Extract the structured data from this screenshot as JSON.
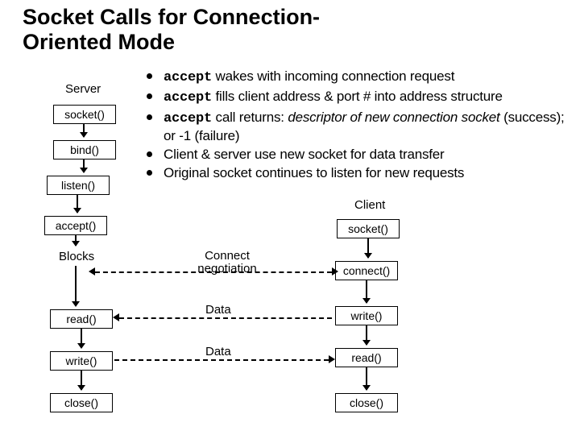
{
  "title": "Socket Calls for Connection-Oriented Mode",
  "title_line1": "Socket Calls for Connection-",
  "title_line2": "Oriented Mode",
  "bullets": {
    "b1_mono": "accept",
    "b1_rest": " wakes with incoming connection request",
    "b2_mono": "accept",
    "b2_rest": " fills client address & port # into address structure",
    "b3_mono": "accept",
    "b3_mid": " call returns: ",
    "b3_em": "descriptor of new connection socket",
    "b3_tail": " (success); or -1 (failure)",
    "b4": "Client & server use new socket for data transfer",
    "b5": "Original socket continues to listen for new requests"
  },
  "labels": {
    "server": "Server",
    "client": "Client",
    "blocks": "Blocks",
    "connect_neg": "Connect negotiation",
    "data": "Data"
  },
  "server_boxes": [
    "socket()",
    "bind()",
    "listen()",
    "accept()",
    "read()",
    "write()",
    "close()"
  ],
  "client_boxes": [
    "socket()",
    "connect()",
    "write()",
    "read()",
    "close()"
  ]
}
